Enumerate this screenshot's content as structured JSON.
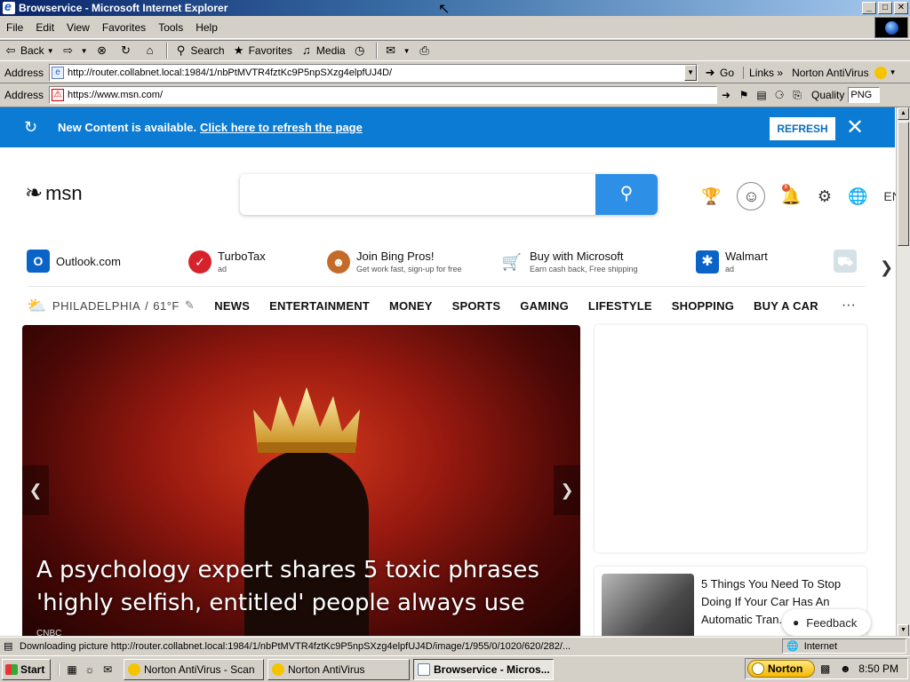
{
  "window": {
    "title": "Browservice - Microsoft Internet Explorer",
    "minimize": "_",
    "maximize": "□",
    "close": "✕"
  },
  "menu": [
    "File",
    "Edit",
    "View",
    "Favorites",
    "Tools",
    "Help"
  ],
  "toolbar": {
    "back": "Back",
    "search": "Search",
    "favorites": "Favorites",
    "media": "Media"
  },
  "ie_address": {
    "label": "Address",
    "url": "http://router.collabnet.local:1984/1/nbPtMVTR4fztKc9P5npSXzg4elpfUJ4D/",
    "go": "Go",
    "links": "Links",
    "norton": "Norton AntiVirus"
  },
  "inner_address": {
    "label": "Address",
    "url": "https://www.msn.com/",
    "quality_label": "Quality",
    "quality_value": "PNG"
  },
  "banner": {
    "message": "New Content is available.",
    "link": "Click here to refresh the page",
    "button": "REFRESH"
  },
  "msn": {
    "logo": "msn",
    "language": "EN",
    "notification_count": "8"
  },
  "quicklinks": [
    {
      "title": "Outlook.com",
      "sub": ""
    },
    {
      "title": "TurboTax",
      "sub": "ad"
    },
    {
      "title": "Join Bing Pros!",
      "sub": "Get work fast, sign-up for free"
    },
    {
      "title": "Buy with Microsoft",
      "sub": "Earn cash back, Free shipping"
    },
    {
      "title": "Walmart",
      "sub": "ad"
    }
  ],
  "weather": {
    "city": "PHILADELPHIA",
    "temp": "61°F"
  },
  "nav": [
    "NEWS",
    "ENTERTAINMENT",
    "MONEY",
    "SPORTS",
    "GAMING",
    "LIFESTYLE",
    "SHOPPING",
    "BUY A CAR"
  ],
  "hero": {
    "headline": "A psychology expert shares 5 toxic phrases 'highly selfish, entitled' people always use—...",
    "source": "CNBC"
  },
  "card": {
    "title": "5 Things You Need To Stop Doing If Your Car Has An Automatic Tran..."
  },
  "feedback": "Feedback",
  "status": {
    "text": "Downloading picture http://router.collabnet.local:1984/1/nbPtMVTR4fztKc9P5npSXzg4elpfUJ4D/image/1/955/0/1020/620/282/...",
    "zone": "Internet"
  },
  "taskbar": {
    "start": "Start",
    "tasks": [
      "Norton AntiVirus - Scan",
      "Norton AntiVirus",
      "Browservice - Micros..."
    ],
    "norton": "Norton",
    "clock": "8:50 PM"
  }
}
